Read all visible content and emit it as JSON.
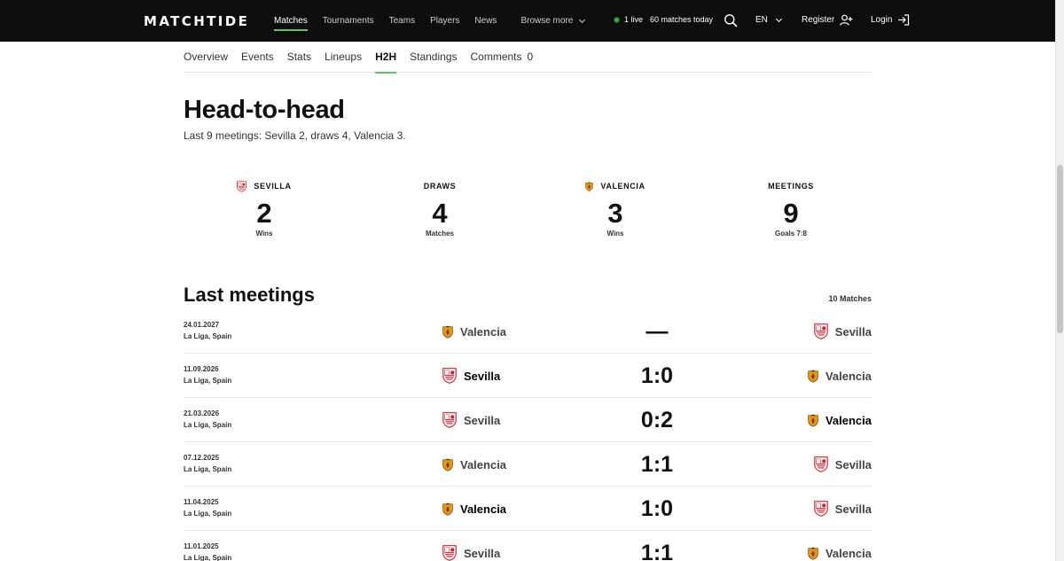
{
  "header": {
    "logo": "MATCHTIDE",
    "nav": [
      {
        "label": "Matches",
        "active": true
      },
      {
        "label": "Tournaments"
      },
      {
        "label": "Teams"
      },
      {
        "label": "Players"
      },
      {
        "label": "News"
      }
    ],
    "browse_more": "Browse more",
    "live_count": "1 live",
    "matches_today": "60 matches today",
    "language": "EN",
    "register": "Register",
    "login": "Login"
  },
  "tabs": [
    {
      "label": "Overview"
    },
    {
      "label": "Events"
    },
    {
      "label": "Stats"
    },
    {
      "label": "Lineups"
    },
    {
      "label": "H2H",
      "active": true
    },
    {
      "label": "Standings"
    },
    {
      "label": "Comments",
      "count": "0"
    }
  ],
  "h2h": {
    "title": "Head-to-head",
    "subtitle": "Last 9 meetings: Sevilla 2, draws 4, Valencia 3.",
    "stats": {
      "sevilla": {
        "label": "SEVILLA",
        "value": "2",
        "caption": "Wins"
      },
      "draws": {
        "label": "DRAWS",
        "value": "4",
        "caption": "Matches"
      },
      "valencia": {
        "label": "VALENCIA",
        "value": "3",
        "caption": "Wins"
      },
      "meetings": {
        "label": "MEETINGS",
        "value": "9",
        "caption": "Goals 7:8"
      }
    }
  },
  "last_meetings": {
    "title": "Last meetings",
    "count": "10 Matches",
    "rows": [
      {
        "date": "24.01.2027",
        "league": "La Liga, Spain",
        "home": "Valencia",
        "home_crest": "valencia",
        "score": "—",
        "away": "Sevilla",
        "away_crest": "sevilla",
        "winner": ""
      },
      {
        "date": "11.09.2026",
        "league": "La Liga, Spain",
        "home": "Sevilla",
        "home_crest": "sevilla",
        "score": "1:0",
        "away": "Valencia",
        "away_crest": "valencia",
        "winner": "home"
      },
      {
        "date": "21.03.2026",
        "league": "La Liga, Spain",
        "home": "Sevilla",
        "home_crest": "sevilla",
        "score": "0:2",
        "away": "Valencia",
        "away_crest": "valencia",
        "winner": "away"
      },
      {
        "date": "07.12.2025",
        "league": "La Liga, Spain",
        "home": "Valencia",
        "home_crest": "valencia",
        "score": "1:1",
        "away": "Sevilla",
        "away_crest": "sevilla",
        "winner": ""
      },
      {
        "date": "11.04.2025",
        "league": "La Liga, Spain",
        "home": "Valencia",
        "home_crest": "valencia",
        "score": "1:0",
        "away": "Sevilla",
        "away_crest": "sevilla",
        "winner": "home"
      },
      {
        "date": "11.01.2025",
        "league": "La Liga, Spain",
        "home": "Sevilla",
        "home_crest": "sevilla",
        "score": "1:1",
        "away": "Valencia",
        "away_crest": "valencia",
        "winner": ""
      }
    ]
  },
  "colors": {
    "accent": "#55c860",
    "live": "#2fb64b",
    "sevilla_red": "#d8202c",
    "valencia_orange": "#f29400"
  }
}
